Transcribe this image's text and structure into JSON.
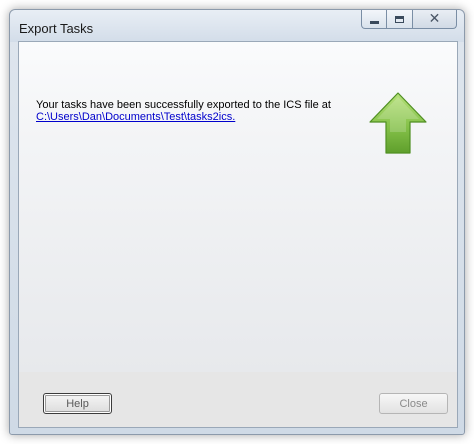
{
  "window": {
    "title": "Export Tasks"
  },
  "message": {
    "text": "Your tasks have been successfully exported to the ICS file at",
    "path": "C:\\Users\\Dan\\Documents\\Test\\tasks2ics."
  },
  "footer": {
    "help_label": "Help",
    "close_label": "Close"
  },
  "icons": {
    "minimize": "minimize-icon",
    "maximize": "maximize-icon",
    "close": "close-icon",
    "arrow": "green-up-arrow-icon"
  },
  "colors": {
    "link": "#0000cc",
    "arrow_fill": "#86c24a",
    "arrow_edge": "#4f8f22"
  }
}
